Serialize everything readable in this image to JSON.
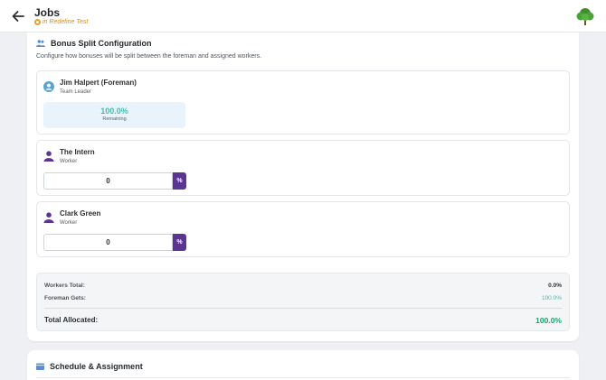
{
  "header": {
    "title": "Jobs",
    "subtitle": "in Redefine Test",
    "icons": {
      "back": "arrow-left-icon",
      "logo": "tree-logo-icon",
      "subtitle": "location-pin-icon"
    }
  },
  "bonus": {
    "title": "Bonus Split Configuration",
    "description": "Configure how bonuses will be split between the foreman and assigned workers.",
    "foreman": {
      "name": "Jim Halpert (Foreman)",
      "role": "Team Leader",
      "remaining_value": "100.0%",
      "remaining_label": "Remaining"
    },
    "workers": [
      {
        "name": "The Intern",
        "role": "Worker",
        "value": "0",
        "unit": "%"
      },
      {
        "name": "Clark Green",
        "role": "Worker",
        "value": "0",
        "unit": "%"
      }
    ],
    "totals": {
      "workers_label": "Workers Total:",
      "workers_value": "0.0%",
      "foreman_label": "Foreman Gets:",
      "foreman_value": "100.0%",
      "total_label": "Total Allocated:",
      "total_value": "100.0%"
    }
  },
  "schedule": {
    "title": "Schedule & Assignment"
  },
  "colors": {
    "accent_purple": "#5a3592",
    "teal": "#4cb8b0",
    "green": "#1f9d6c",
    "orange": "#d98b1b"
  }
}
